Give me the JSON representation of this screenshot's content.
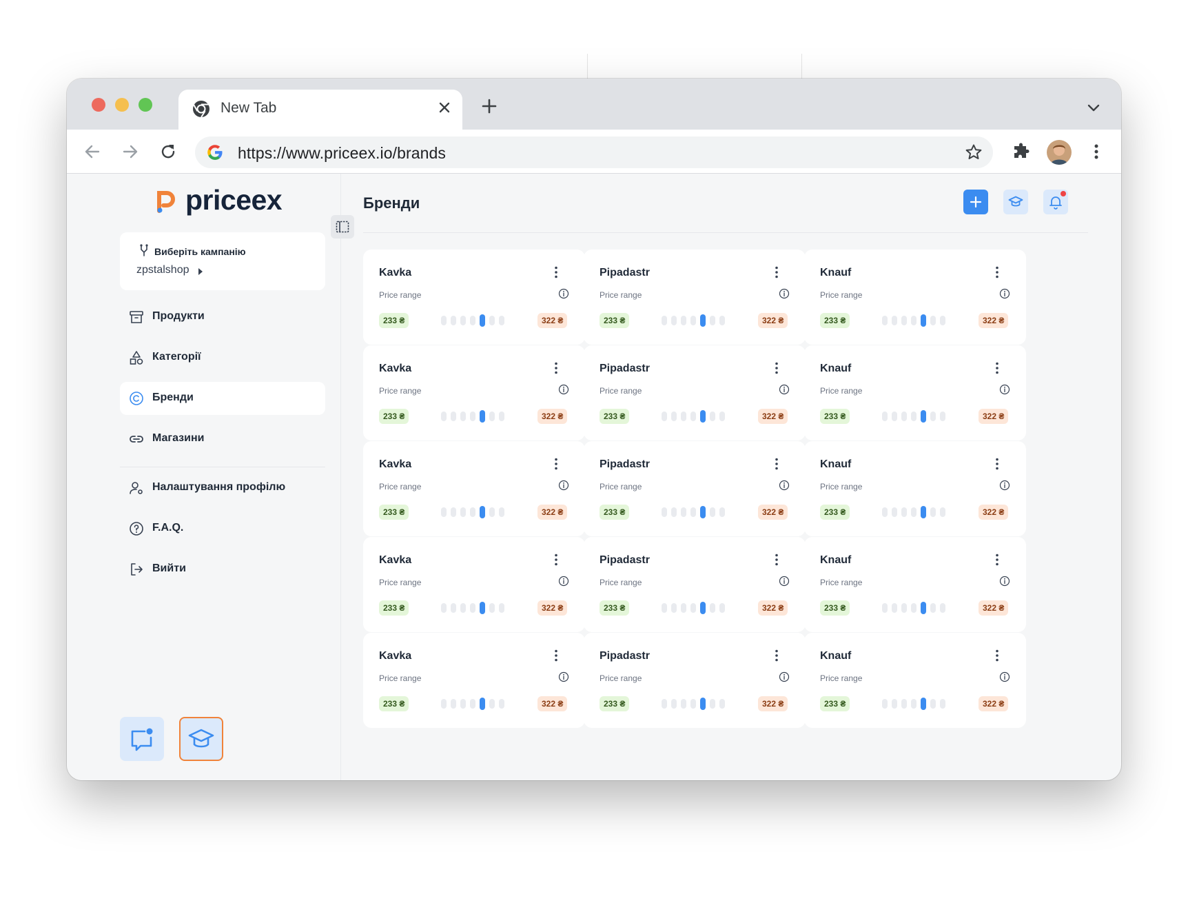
{
  "browser": {
    "tab_title": "New Tab",
    "url": "https://www.priceex.io/brands"
  },
  "app": {
    "logo_text": "priceex",
    "campaign": {
      "label": "Виберіть кампанію",
      "value": "zpstalshop"
    },
    "nav": [
      {
        "label": "Продукти",
        "icon": "archive-icon"
      },
      {
        "label": "Категорії",
        "icon": "shapes-icon"
      },
      {
        "label": "Бренди",
        "icon": "copyright-icon",
        "active": true
      },
      {
        "label": "Магазини",
        "icon": "link-icon"
      },
      {
        "label": "Налаштування профілю",
        "icon": "user-settings-icon"
      },
      {
        "label": "F.A.Q.",
        "icon": "help-circle-icon"
      },
      {
        "label": "Вийти",
        "icon": "logout-icon"
      }
    ],
    "page_title": "Бренди",
    "colors": {
      "accent": "#3b8cf0",
      "logo_orange": "#f0833a",
      "notify": "#ef4444"
    },
    "brands": {
      "range_label": "Price range",
      "cards": [
        {
          "name": "Kavka",
          "min": "233 ₴",
          "max": "322 ₴",
          "level": 5
        },
        {
          "name": "Pipadastr",
          "min": "233 ₴",
          "max": "322 ₴",
          "level": 5
        },
        {
          "name": "Knauf",
          "min": "233 ₴",
          "max": "322 ₴",
          "level": 5
        },
        {
          "name": "Kavka",
          "min": "233 ₴",
          "max": "322 ₴",
          "level": 5
        },
        {
          "name": "Pipadastr",
          "min": "233 ₴",
          "max": "322 ₴",
          "level": 5
        },
        {
          "name": "Knauf",
          "min": "233 ₴",
          "max": "322 ₴",
          "level": 5
        },
        {
          "name": "Kavka",
          "min": "233 ₴",
          "max": "322 ₴",
          "level": 5
        },
        {
          "name": "Pipadastr",
          "min": "233 ₴",
          "max": "322 ₴",
          "level": 5
        },
        {
          "name": "Knauf",
          "min": "233 ₴",
          "max": "322 ₴",
          "level": 5
        },
        {
          "name": "Kavka",
          "min": "233 ₴",
          "max": "322 ₴",
          "level": 5
        },
        {
          "name": "Pipadastr",
          "min": "233 ₴",
          "max": "322 ₴",
          "level": 5
        },
        {
          "name": "Knauf",
          "min": "233 ₴",
          "max": "322 ₴",
          "level": 5
        },
        {
          "name": "Kavka",
          "min": "233 ₴",
          "max": "322 ₴",
          "level": 5
        },
        {
          "name": "Pipadastr",
          "min": "233 ₴",
          "max": "322 ₴",
          "level": 5
        },
        {
          "name": "Knauf",
          "min": "233 ₴",
          "max": "322 ₴",
          "level": 5
        }
      ]
    }
  }
}
